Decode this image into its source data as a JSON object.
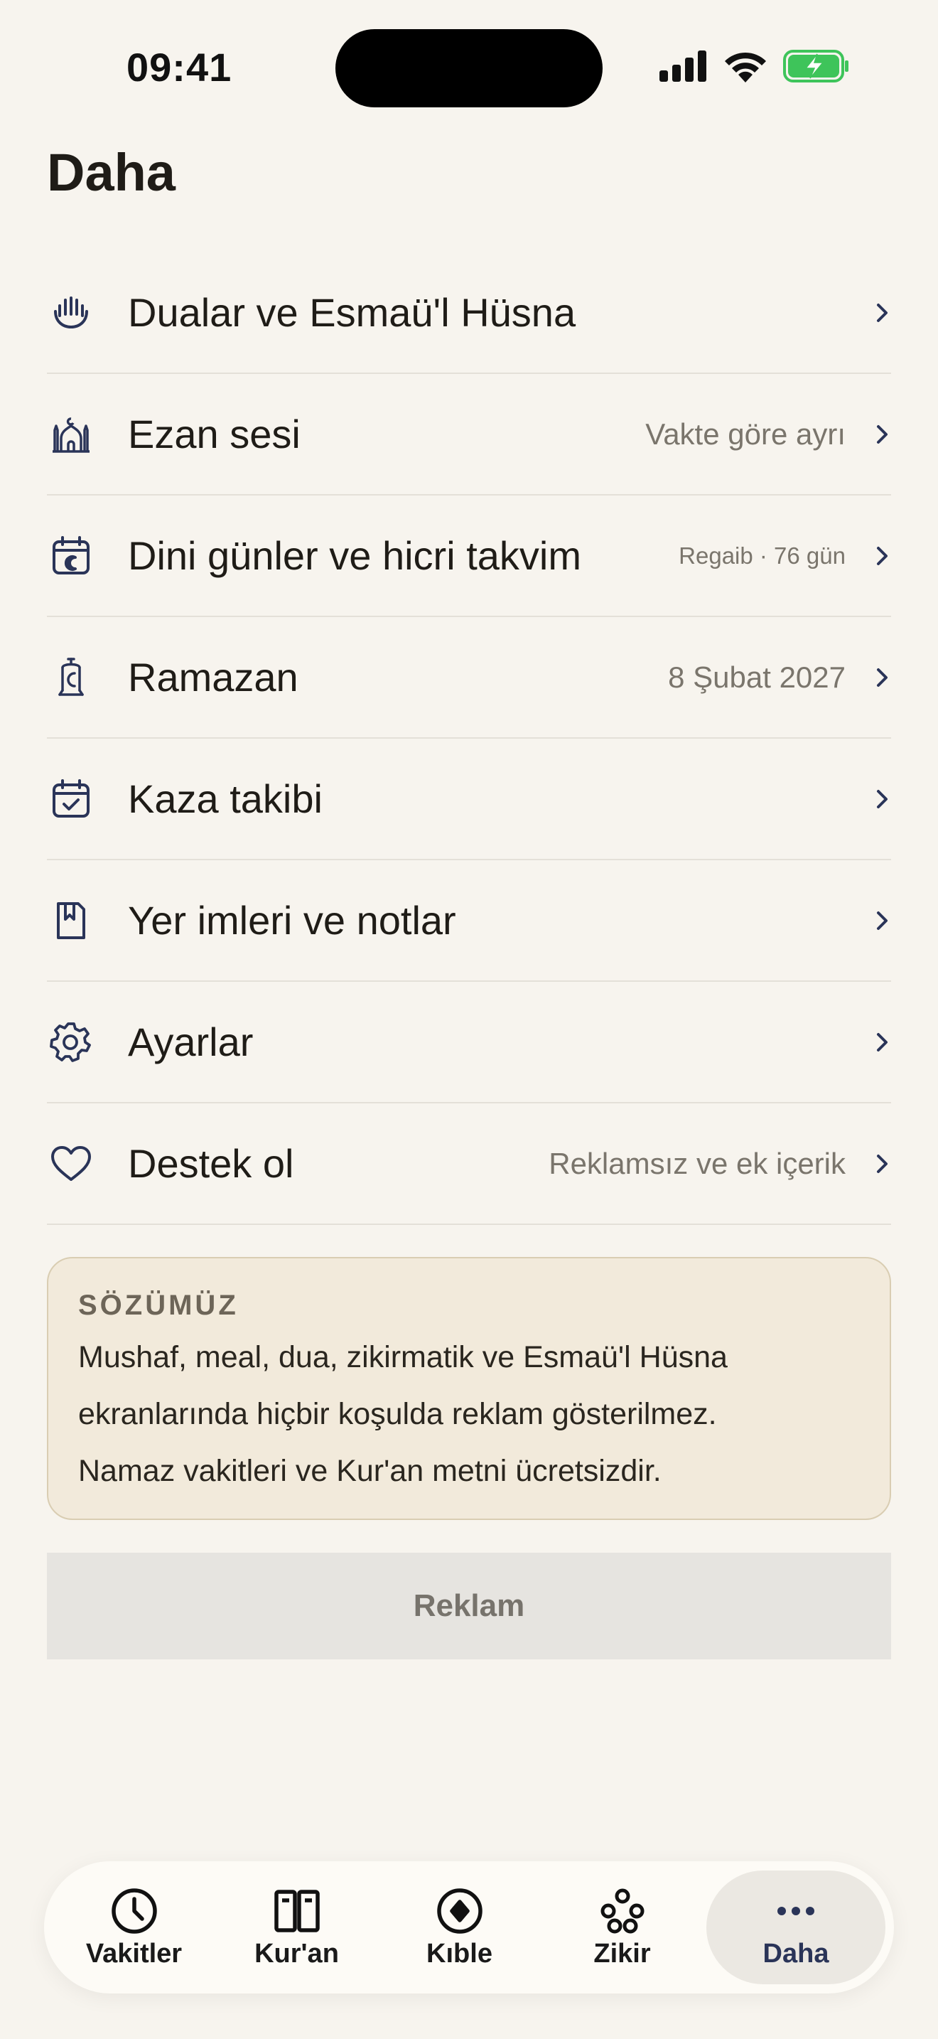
{
  "status_bar": {
    "time": "09:41"
  },
  "page": {
    "title": "Daha"
  },
  "menu": [
    {
      "label": "Dualar ve Esmaü'l Hüsna",
      "detail": "",
      "icon": "hands-icon"
    },
    {
      "label": "Ezan sesi",
      "detail": "Vakte göre ayrı",
      "icon": "mosque-icon"
    },
    {
      "label": "Dini günler ve hicri takvim",
      "detail": "Regaib · 76 gün",
      "icon": "calendar-moon-icon"
    },
    {
      "label": "Ramazan",
      "detail": "8 Şubat 2027",
      "icon": "lantern-icon"
    },
    {
      "label": "Kaza takibi",
      "detail": "",
      "icon": "calendar-check-icon"
    },
    {
      "label": "Yer imleri ve notlar",
      "detail": "",
      "icon": "bookmark-icon"
    },
    {
      "label": "Ayarlar",
      "detail": "",
      "icon": "gear-icon"
    },
    {
      "label": "Destek ol",
      "detail": "Reklamsız ve ek içerik",
      "icon": "heart-icon"
    }
  ],
  "promise": {
    "heading": "SÖZÜMÜZ",
    "line1": "Mushaf, meal, dua, zikirmatik ve Esmaü'l Hüsna",
    "line2": "ekranlarında hiçbir koşulda reklam gösterilmez.",
    "line3": "Namaz vakitleri ve Kur'an metni ücretsizdir."
  },
  "ad": {
    "label": "Reklam"
  },
  "tabs": [
    {
      "label": "Vakitler",
      "icon": "clock-icon"
    },
    {
      "label": "Kur'an",
      "icon": "book-icon"
    },
    {
      "label": "Kıble",
      "icon": "compass-icon"
    },
    {
      "label": "Zikir",
      "icon": "beads-icon"
    },
    {
      "label": "Daha",
      "icon": "more-icon",
      "active": true
    }
  ],
  "colors": {
    "background": "#f7f4ee",
    "icon_navy": "#2a3458",
    "battery_green": "#3ec45a",
    "card_bg": "#f2eadb"
  }
}
